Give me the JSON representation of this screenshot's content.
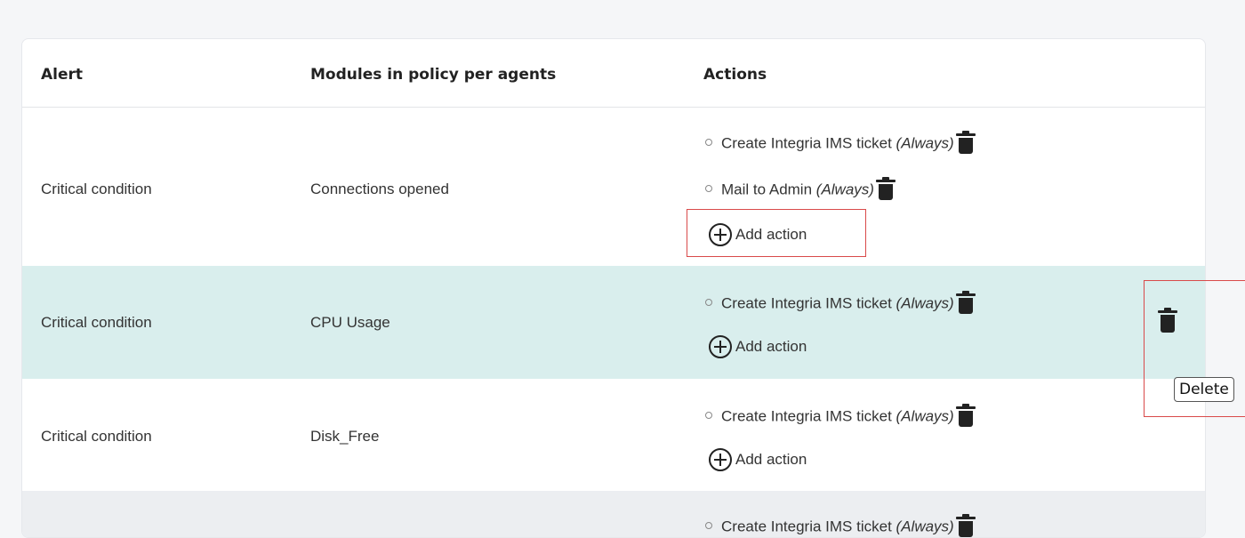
{
  "table": {
    "headers": {
      "alert": "Alert",
      "modules": "Modules in policy per agents",
      "actions": "Actions"
    },
    "rows": [
      {
        "alert": "Critical condition",
        "module": "Connections opened",
        "actions": [
          {
            "name": "Create Integria IMS ticket",
            "mode": "(Always)"
          },
          {
            "name": "Mail to Admin",
            "mode": "(Always)"
          }
        ],
        "add_label": "Add action"
      },
      {
        "alert": "Critical condition",
        "module": "CPU Usage",
        "actions": [
          {
            "name": "Create Integria IMS ticket",
            "mode": "(Always)"
          }
        ],
        "add_label": "Add action"
      },
      {
        "alert": "Critical condition",
        "module": "Disk_Free",
        "actions": [
          {
            "name": "Create Integria IMS ticket",
            "mode": "(Always)"
          }
        ],
        "add_label": "Add action"
      },
      {
        "actions": [
          {
            "name": "Create Integria IMS ticket",
            "mode": "(Always)"
          }
        ]
      }
    ]
  },
  "tooltip": {
    "label": "Delete"
  },
  "colors": {
    "highlight_row": "#d9eeed",
    "annotation_box": "#d94a4a"
  }
}
